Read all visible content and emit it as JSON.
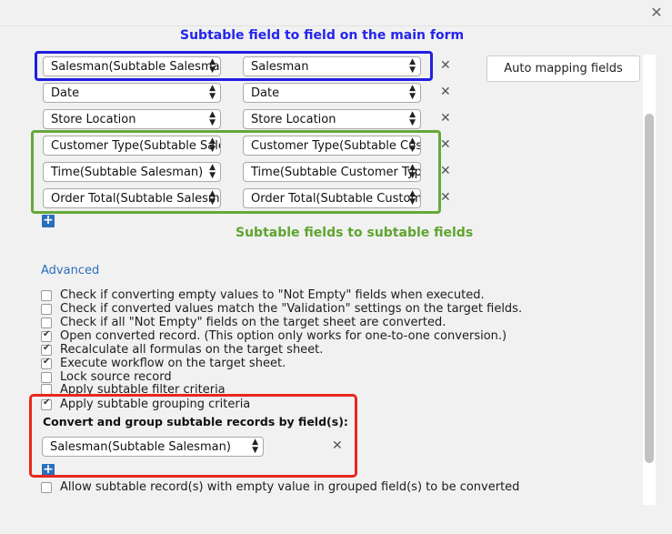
{
  "annotations": {
    "main_form": "Subtable field to field on the main form",
    "subtable": "Subtable fields to subtable fields"
  },
  "auto_mapping_label": "Auto mapping fields",
  "mappings": [
    {
      "source": "Salesman(Subtable Salesman)",
      "target": "Salesman"
    },
    {
      "source": "Date",
      "target": "Date"
    },
    {
      "source": "Store Location",
      "target": "Store Location"
    },
    {
      "source": "Customer Type(Subtable Salesman)",
      "target": "Customer Type(Subtable Customer Type)"
    },
    {
      "source": "Time(Subtable Salesman)",
      "target": "Time(Subtable Customer Type)"
    },
    {
      "source": "Order Total(Subtable Salesman)",
      "target": "Order Total(Subtable Customer Type)"
    }
  ],
  "advanced_label": "Advanced",
  "options": [
    {
      "label": "Check if converting empty values to \"Not Empty\" fields when executed.",
      "checked": false
    },
    {
      "label": "Check if converted values match the \"Validation\" settings on the target fields.",
      "checked": false
    },
    {
      "label": "Check if all \"Not Empty\" fields on the target sheet are converted.",
      "checked": false
    },
    {
      "label": "Open converted record. (This option only works for one-to-one conversion.)",
      "checked": true
    },
    {
      "label": "Recalculate all formulas on the target sheet.",
      "checked": true
    },
    {
      "label": "Execute workflow on the target sheet.",
      "checked": true
    },
    {
      "label": "Lock source record",
      "checked": false
    },
    {
      "label": "Apply subtable filter criteria",
      "checked": false
    },
    {
      "label": "Apply subtable grouping criteria",
      "checked": true
    }
  ],
  "group_title": "Convert and group subtable records by field(s):",
  "group_field": "Salesman(Subtable Salesman)",
  "allow_empty": {
    "label": "Allow subtable record(s) with empty value in grouped field(s) to be converted",
    "checked": false
  },
  "icons": {
    "close": "close-icon",
    "remove": "remove-icon",
    "add": "add-icon"
  },
  "colors": {
    "annot_blue": "#2424ee",
    "annot_green": "#5ea52f",
    "box_red": "#e8271d",
    "link": "#2a6fba"
  }
}
